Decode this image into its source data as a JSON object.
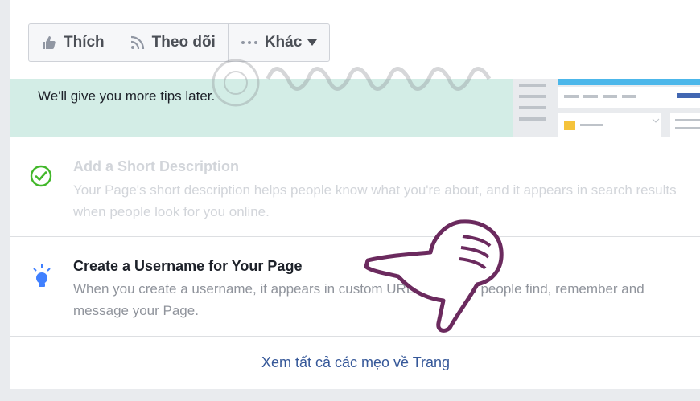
{
  "actions": {
    "like_label": "Thích",
    "follow_label": "Theo dõi",
    "more_label": "Khác"
  },
  "banner": {
    "text": "We'll give you more tips later."
  },
  "tips": [
    {
      "title": "Add a Short Description",
      "description": "Your Page's short description helps people know what you're about, and it appears in search results when people look for you online.",
      "status": "done"
    },
    {
      "title": "Create a Username for Your Page",
      "description": "When you create a username, it appears in custom URLs that help people find, remember and message your Page.",
      "status": "pending"
    }
  ],
  "see_all_label": "Xem tất cả các mẹo về Trang",
  "colors": {
    "banner_bg": "#d3ede6",
    "link": "#365899",
    "check": "#42b72a",
    "bulb": "#4080ff",
    "hand": "#6b2a5e"
  },
  "icons": [
    "like-icon",
    "rss-icon",
    "more-dots-icon",
    "dropdown-arrow-icon",
    "check-circle-icon",
    "lightbulb-icon"
  ]
}
